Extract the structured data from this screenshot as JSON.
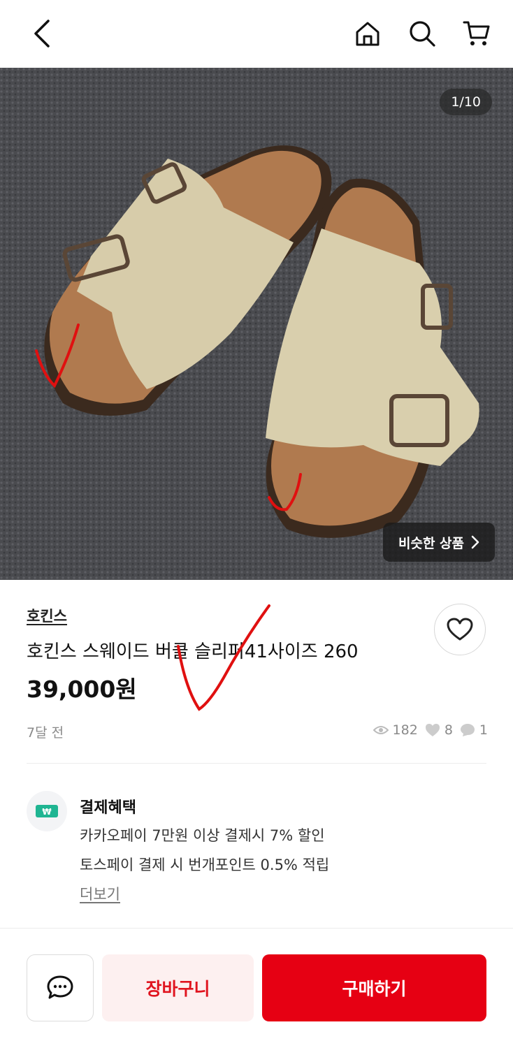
{
  "photo": {
    "counter": "1/10",
    "similar_label": "비슷한 상품"
  },
  "product": {
    "brand": "호킨스",
    "title": "호킨스 스웨이드 버클 슬리퍼41사이즈 260",
    "price": "39,000원",
    "posted": "7달 전",
    "views": "182",
    "likes": "8",
    "chats": "1"
  },
  "benefits": {
    "title": "결제혜택",
    "line1": "카카오페이 7만원 이상 결제시 7% 할인",
    "line2": "토스페이 결제 시 번개포인트 0.5% 적립",
    "more": "더보기"
  },
  "actions": {
    "cart": "장바구니",
    "buy": "구매하기"
  },
  "colors": {
    "accent": "#e60013",
    "cart_bg": "#fdf0f0"
  },
  "icons": [
    "back-icon",
    "home-icon",
    "search-icon",
    "cart-icon",
    "heart-icon",
    "eye-icon",
    "chat-icon",
    "won-icon"
  ]
}
